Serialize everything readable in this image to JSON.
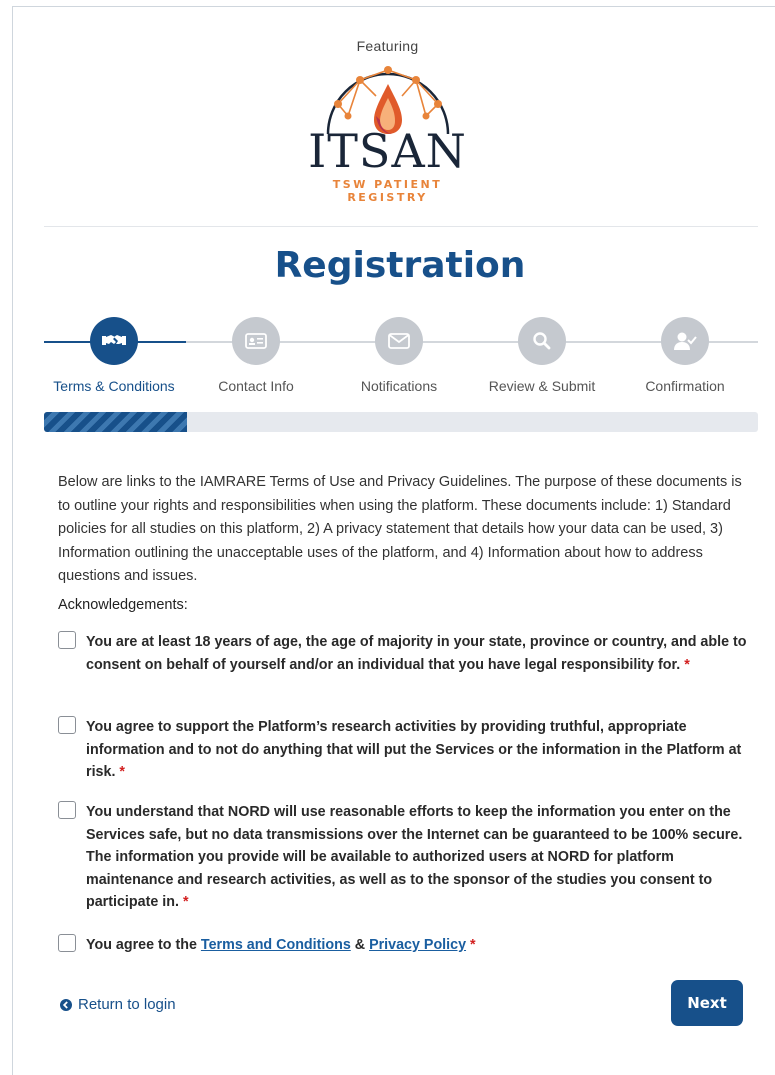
{
  "logo": {
    "featuring": "Featuring",
    "wordmark": "ITSAN",
    "subline1": "TSW PATIENT",
    "subline2": "REGISTRY"
  },
  "page": {
    "title": "Registration"
  },
  "colors": {
    "primary": "#17508a",
    "inactive_step": "#c5c9cf",
    "required": "#d21f1f",
    "logo_orange": "#e8843a"
  },
  "steps": [
    {
      "label": "Terms & Conditions",
      "icon": "handshake-icon",
      "active": true
    },
    {
      "label": "Contact Info",
      "icon": "id-card-icon",
      "active": false
    },
    {
      "label": "Notifications",
      "icon": "envelope-icon",
      "active": false
    },
    {
      "label": "Review & Submit",
      "icon": "search-icon",
      "active": false
    },
    {
      "label": "Confirmation",
      "icon": "user-check-icon",
      "active": false
    }
  ],
  "progress": {
    "fraction": 0.2
  },
  "intro_text": "Below are links to the IAMRARE Terms of Use and Privacy Guidelines. The purpose of these documents is to outline your rights and responsibilities when using the platform. These documents include: 1) Standard policies for all studies on this platform, 2) A privacy statement that details how your data can be used, 3) Information outlining the unacceptable uses of the platform, and 4) Information about how to address questions and issues.",
  "acknowledgements": {
    "heading": "Acknowledgements:",
    "items": [
      {
        "text": "You are at least 18 years of age, the age of majority in your state, province or country, and able to consent on behalf of yourself and/or an individual that you have legal responsibility for.",
        "required_mark": "*",
        "checked": false
      },
      {
        "text": "You agree to support the Platform’s research activities by providing truthful, appropriate information and to not do anything that will put the Services or the information in the Platform at risk.",
        "required_mark": "*",
        "checked": false
      },
      {
        "text": "You understand that NORD will use reasonable efforts to keep the information you enter on the Services safe, but no data transmissions over the Internet can be guaranteed to be 100% secure. The information you provide will be available to authorized users at NORD for platform maintenance and research activities, as well as to the sponsor of the studies you consent to participate in.",
        "required_mark": "*",
        "checked": false
      }
    ],
    "terms_item": {
      "prefix": "You agree to the ",
      "terms_link": "Terms and Conditions",
      "joiner": " & ",
      "privacy_link": "Privacy Policy",
      "required_mark": "*",
      "checked": false
    }
  },
  "footer": {
    "return_label": "Return to login",
    "next_label": "Next"
  }
}
